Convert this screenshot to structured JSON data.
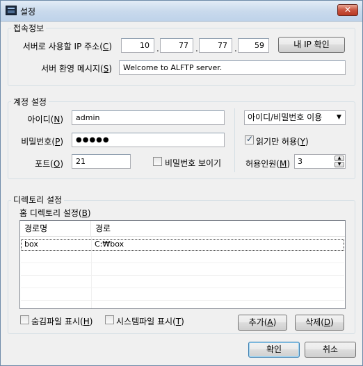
{
  "window": {
    "title": "설정",
    "close_glyph": "✕"
  },
  "connection": {
    "group_label": "접속정보",
    "ip_label": "서버로 사용할 IP 주소(",
    "ip_key": "C",
    "ip_parts": [
      "10",
      "77",
      "77",
      "59"
    ],
    "my_ip_button": "내 IP 확인",
    "welcome_label": "서버 환영 메시지(",
    "welcome_key": "S",
    "welcome_value": "Welcome to ALFTP server."
  },
  "account": {
    "group_label": "계정 설정",
    "id_label": "아이디(",
    "id_key": "N",
    "id_value": "admin",
    "password_label": "비밀번호(",
    "password_key": "P",
    "password_value": "●●●●●",
    "port_label": "포트(",
    "port_key": "O",
    "port_value": "21",
    "show_password_label": "비밀번호 보이기",
    "auth_mode_value": "아이디/비밀번호 이용",
    "read_only_label": "읽기만 허용(",
    "read_only_key": "Y",
    "read_only_checked": true,
    "max_users_label": "허용인원(",
    "max_users_key": "M",
    "max_users_value": "3"
  },
  "directory": {
    "group_label": "디렉토리 설정",
    "home_label": "홈 디렉토리 설정(",
    "home_key": "B",
    "columns": [
      "경로명",
      "경로"
    ],
    "rows": [
      {
        "name": "box",
        "path": "C:₩box"
      }
    ],
    "hidden_files_label": "숨김파일 표시(",
    "hidden_files_key": "H",
    "system_files_label": "시스템파일 표시(",
    "system_files_key": "T",
    "add_button": "추가(",
    "add_key": "A",
    "delete_button": "삭제(",
    "delete_key": "D"
  },
  "footer": {
    "ok_button": "확인",
    "cancel_button": "취소"
  }
}
